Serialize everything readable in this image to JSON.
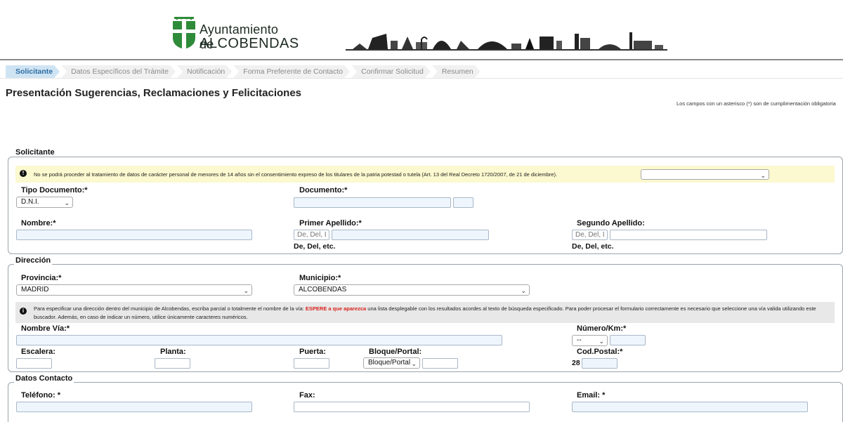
{
  "header": {
    "logo_line1": "Ayuntamiento de",
    "logo_line2": "ALCOBENDAS"
  },
  "steps": [
    {
      "label": "Solicitante",
      "active": true
    },
    {
      "label": "Datos Específicos del Trámite",
      "active": false
    },
    {
      "label": "Notificación",
      "active": false
    },
    {
      "label": "Forma Preferente de Contacto",
      "active": false
    },
    {
      "label": "Confirmar Solicitud",
      "active": false
    },
    {
      "label": "Resumen",
      "active": false
    }
  ],
  "page": {
    "title": "Presentación Sugerencias, Reclamaciones y Felicitaciones",
    "required_note": "Los campos con un asterisco (*) son de cumplimentación obligatoria"
  },
  "solicitante": {
    "legend": "Solicitante",
    "notice": "No se podrá proceder al tratamiento de datos de carácter personal de menores de 14 años sin el consentimiento expreso de los titulares de la patria potestad o tutela (Art. 13 del Real Decreto 1720/2007, de 21 de diciembre).",
    "notice_select_value": "",
    "tipo_documento_label": "Tipo Documento:*",
    "tipo_documento_value": "D.N.I.",
    "documento_label": "Documento:*",
    "documento_value": "",
    "documento_letra_value": "",
    "nombre_label": "Nombre:*",
    "nombre_value": "",
    "primer_apellido_label": "Primer Apellido:*",
    "primer_apellido_particula_placeholder": "De, Del, La",
    "primer_apellido_value": "",
    "primer_apellido_hint": "De, Del, etc.",
    "segundo_apellido_label": "Segundo Apellido:",
    "segundo_apellido_particula_placeholder": "De, Del, La",
    "segundo_apellido_value": "",
    "segundo_apellido_hint": "De, Del, etc."
  },
  "direccion": {
    "legend": "Dirección",
    "provincia_label": "Provincia:*",
    "provincia_value": "MADRID",
    "municipio_label": "Municipio:*",
    "municipio_value": "ALCOBENDAS",
    "notice_part1": "Para especificar una dirección dentro del municipio de Alcobendas, escriba parcial o totalmente el nombre de la vía: ",
    "notice_highlight": "ESPERE a que aparezca",
    "notice_part2": " una lista desplegable con los resultados acordes al texto de búsqueda especificado. Para poder procesar el formulario correctamente es necesario que seleccione una vía valida utilizando este buscador. Además, en caso de indicar un número, utilice únicamente caracteres numéricos.",
    "nombre_via_label": "Nombre Vía:*",
    "numero_label": "Número/Km:*",
    "numero_select_value": "--",
    "escalera_label": "Escalera:",
    "planta_label": "Planta:",
    "puerta_label": "Puerta:",
    "bloque_label": "Bloque/Portal:",
    "bloque_select_value": "Bloque/Portal",
    "cod_postal_label": "Cod.Postal:*",
    "cod_postal_prefix": "28"
  },
  "contacto": {
    "legend": "Datos Contacto",
    "telefono_label": "Teléfono: *",
    "fax_label": "Fax:",
    "email_label": "Email: *"
  },
  "colors": {
    "active_step_bg": "#cfe4f3",
    "active_step_text": "#2e6da4",
    "input_bg": "#eef5fd",
    "notice_yellow": "#fcf8cf",
    "notice_gray": "#e8e8e8",
    "highlight_red": "#d9211b",
    "logo_green": "#2e8b3a"
  }
}
